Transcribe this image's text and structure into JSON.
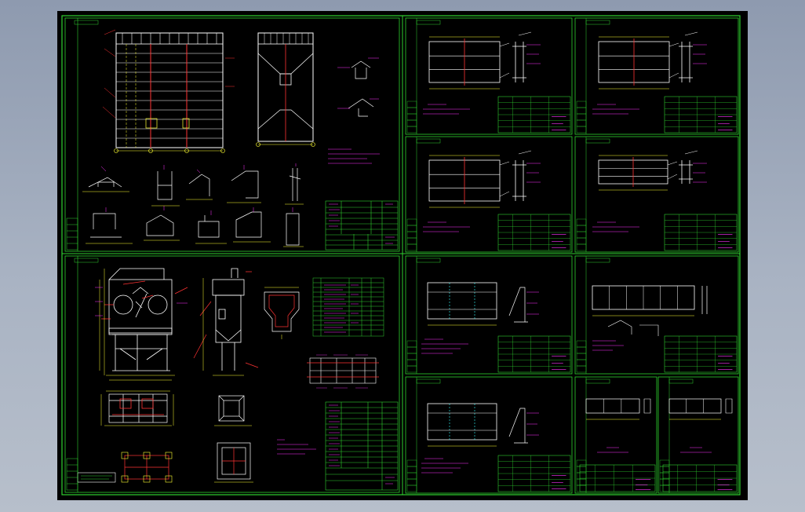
{
  "viewer": {
    "background": "#000000",
    "frame_color": "#2fd12f",
    "line_white": "#ffffff",
    "line_yellow": "#ffff33",
    "line_magenta": "#ff33ff",
    "line_red": "#ff3333",
    "line_cyan": "#33ffff",
    "line_green": "#2fd12f"
  },
  "sheets": [
    {
      "id": "main-assembly"
    },
    {
      "id": "panel-1"
    },
    {
      "id": "panel-2"
    },
    {
      "id": "panel-3"
    },
    {
      "id": "panel-4"
    },
    {
      "id": "general-arrangement"
    },
    {
      "id": "panel-5"
    },
    {
      "id": "panel-6"
    },
    {
      "id": "panel-7"
    },
    {
      "id": "detail-a"
    },
    {
      "id": "detail-b"
    }
  ]
}
